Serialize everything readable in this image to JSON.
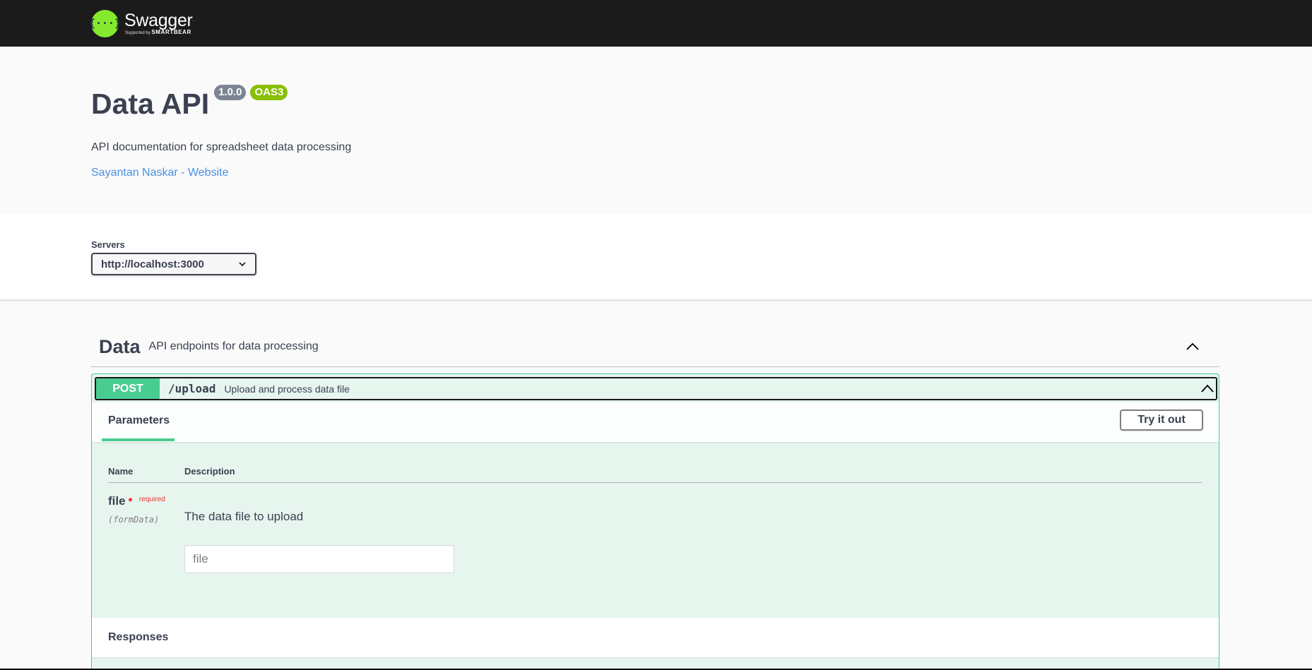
{
  "topbar": {
    "logo_symbol": "{···}",
    "logo_name": "Swagger",
    "logo_tm": ".",
    "logo_sub_prefix": "Supported by",
    "logo_sub_brand": "SMARTBEAR"
  },
  "info": {
    "title": "Data API",
    "version": "1.0.0",
    "oas_badge": "OAS3",
    "description": "API documentation for spreadsheet data processing",
    "contact_link": "Sayantan Naskar - Website"
  },
  "servers": {
    "label": "Servers",
    "selected": "http://localhost:3000"
  },
  "tag": {
    "name": "Data",
    "description": "API endpoints for data processing"
  },
  "operation": {
    "method": "POST",
    "path": "/upload",
    "summary": "Upload and process data file",
    "method_color": "#49cc90",
    "tabs": {
      "parameters": "Parameters"
    },
    "try_it_out": "Try it out",
    "columns": {
      "name": "Name",
      "description": "Description"
    },
    "param": {
      "name": "file",
      "star": "*",
      "required": "required",
      "in": "(formData)",
      "description": "The data file to upload",
      "placeholder": "file"
    },
    "responses_title": "Responses"
  },
  "colors": {
    "topbar": "#1b1b1b",
    "logo": "#85ea2d",
    "link": "#4990e2",
    "post": "#49cc90",
    "oas": "#89bf04",
    "version": "#7d8492"
  }
}
